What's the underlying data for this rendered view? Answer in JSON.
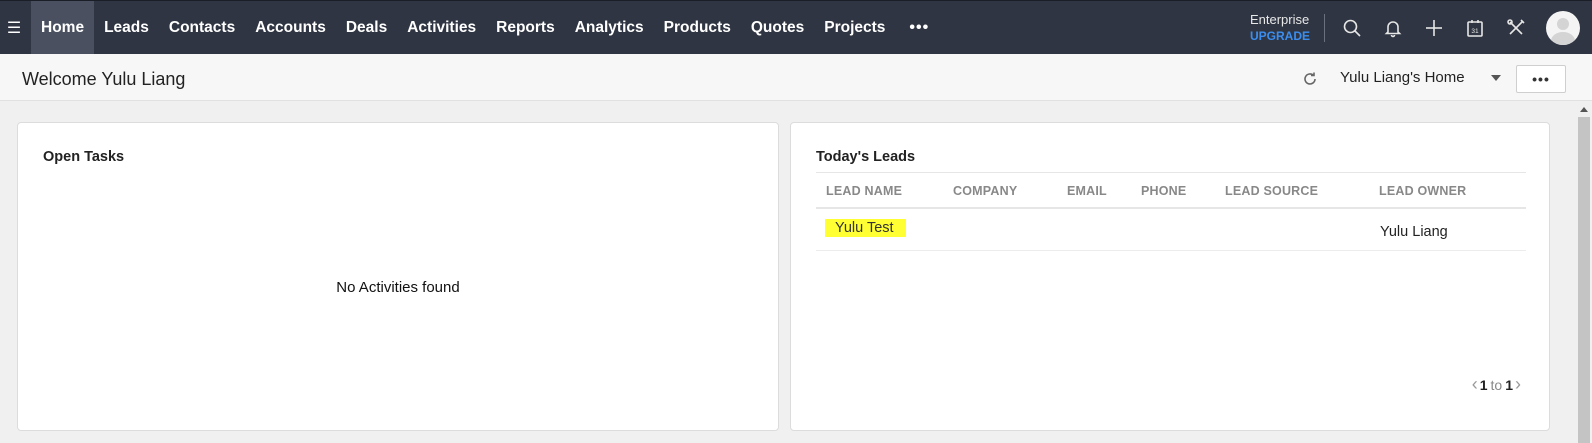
{
  "nav": {
    "menu_icon": "hamburger-icon",
    "tabs": [
      {
        "label": "Home",
        "active": true
      },
      {
        "label": "Leads"
      },
      {
        "label": "Contacts"
      },
      {
        "label": "Accounts"
      },
      {
        "label": "Deals"
      },
      {
        "label": "Activities"
      },
      {
        "label": "Reports"
      },
      {
        "label": "Analytics"
      },
      {
        "label": "Products"
      },
      {
        "label": "Quotes"
      },
      {
        "label": "Projects"
      }
    ],
    "more_label": "•••",
    "plan": {
      "name": "Enterprise",
      "upgrade": "UPGRADE",
      "upgrade_color": "#3b8ef0"
    },
    "icons": [
      "search-icon",
      "bell-icon",
      "plus-icon",
      "calendar-icon",
      "tools-icon",
      "avatar"
    ],
    "calendar_day": "31",
    "bg_color": "#2f3542"
  },
  "subheader": {
    "welcome": "Welcome Yulu Liang",
    "home_view": "Yulu Liang's Home",
    "more_label": "•••"
  },
  "open_tasks": {
    "title": "Open Tasks",
    "empty_message": "No Activities found"
  },
  "todays_leads": {
    "title": "Today's Leads",
    "columns": [
      "LEAD NAME",
      "COMPANY",
      "EMAIL",
      "PHONE",
      "LEAD SOURCE",
      "LEAD OWNER"
    ],
    "rows": [
      {
        "lead_name": "Yulu Test",
        "company": "",
        "email": "",
        "phone": "",
        "lead_source": "",
        "lead_owner": "Yulu Liang"
      }
    ],
    "highlight_color": "#ffff33",
    "pager": {
      "from": "1",
      "to_word": "to",
      "to": "1"
    }
  }
}
